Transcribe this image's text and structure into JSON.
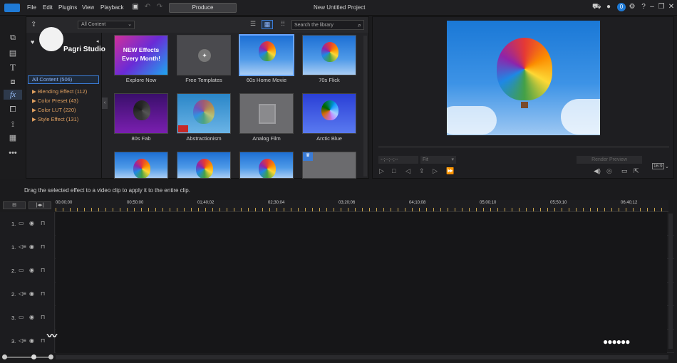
{
  "app": {
    "menus": [
      "File",
      "Edit",
      "Plugins",
      "View",
      "Playback"
    ],
    "produce_label": "Produce",
    "project_title": "New Untitled Project",
    "notification_count": "0",
    "logo_text": "Pagri Studio"
  },
  "library": {
    "search_placeholder": "Search the library",
    "view_select": "All Content",
    "categories": {
      "all": "All Content (506)",
      "items": [
        "▶ Blending Effect (112)",
        "▶ Color Preset (43)",
        "▶ Color LUT (220)",
        "▶ Style Effect (131)"
      ]
    },
    "thumbs": [
      {
        "label": "Explore Now",
        "promo": "NEW Effects Every Month!"
      },
      {
        "label": "Free Templates"
      },
      {
        "label": "60s Home Movie"
      },
      {
        "label": "70s Flick"
      },
      {
        "label": "80s Fab"
      },
      {
        "label": "Abstractionism"
      },
      {
        "label": "Analog Film"
      },
      {
        "label": "Arctic Blue"
      }
    ]
  },
  "preview": {
    "timecode": "--;--;--;--",
    "fit": "Fit",
    "render_label": "Render Preview",
    "ratio": "16:9"
  },
  "hint": "Drag the selected effect to a video clip to apply it to the entire clip.",
  "timeline": {
    "ruler": [
      "00;00;00",
      "00;50;00",
      "01;40;02",
      "02;30;04",
      "03;20;06",
      "04;10;08",
      "05;00;10",
      "05;50;10",
      "06;40;12"
    ],
    "tracks": [
      "1.",
      "1.",
      "2.",
      "2.",
      "3.",
      "3."
    ]
  },
  "colors": {
    "accent": "#3a7bd5",
    "category_text": "#e0a060",
    "ruler_ticks": "#c8a34a"
  }
}
